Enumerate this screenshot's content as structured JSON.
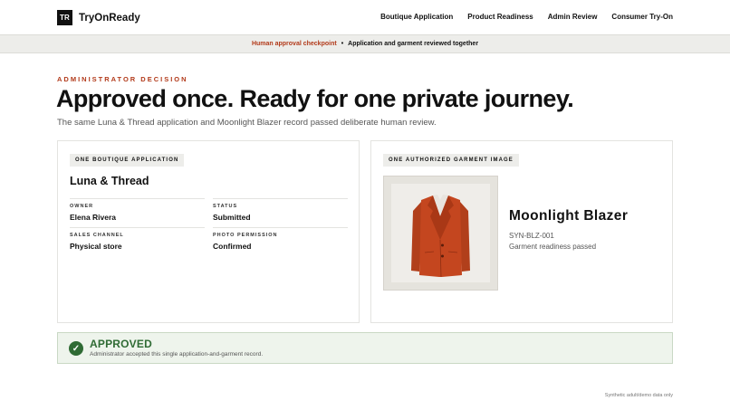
{
  "brand": {
    "mark": "TR",
    "name": "TryOnReady"
  },
  "nav": {
    "links": [
      "Boutique Application",
      "Product Readiness",
      "Admin Review",
      "Consumer Try-On"
    ]
  },
  "banner": {
    "accent": "Human approval checkpoint",
    "separator": "•",
    "text": "Application and garment reviewed together"
  },
  "hero": {
    "eyebrow": "ADMINISTRATOR DECISION",
    "headline": "Approved once. Ready for one private journey.",
    "subline": "The same Luna & Thread application and Moonlight Blazer record passed deliberate human review."
  },
  "application": {
    "chip": "ONE BOUTIQUE APPLICATION",
    "name": "Luna & Thread",
    "fields": [
      {
        "label": "OWNER",
        "value": "Elena Rivera"
      },
      {
        "label": "STATUS",
        "value": "Submitted"
      },
      {
        "label": "SALES CHANNEL",
        "value": "Physical store"
      },
      {
        "label": "PHOTO PERMISSION",
        "value": "Confirmed"
      }
    ]
  },
  "garment": {
    "chip": "ONE AUTHORIZED GARMENT IMAGE",
    "name": "Moonlight Blazer",
    "sku": "SYN-BLZ-001",
    "note": "Garment readiness passed",
    "image_icon": "blazer-image"
  },
  "decision": {
    "icon": "check-icon",
    "title": "APPROVED",
    "subtitle": "Administrator accepted this single application-and-garment record."
  },
  "footer": {
    "note": "Synthetic adult/demo data only"
  },
  "colors": {
    "accent": "#b23a1a",
    "success": "#2f6b34",
    "success_bg": "#eef4ec",
    "blazer": "#c4461f"
  }
}
